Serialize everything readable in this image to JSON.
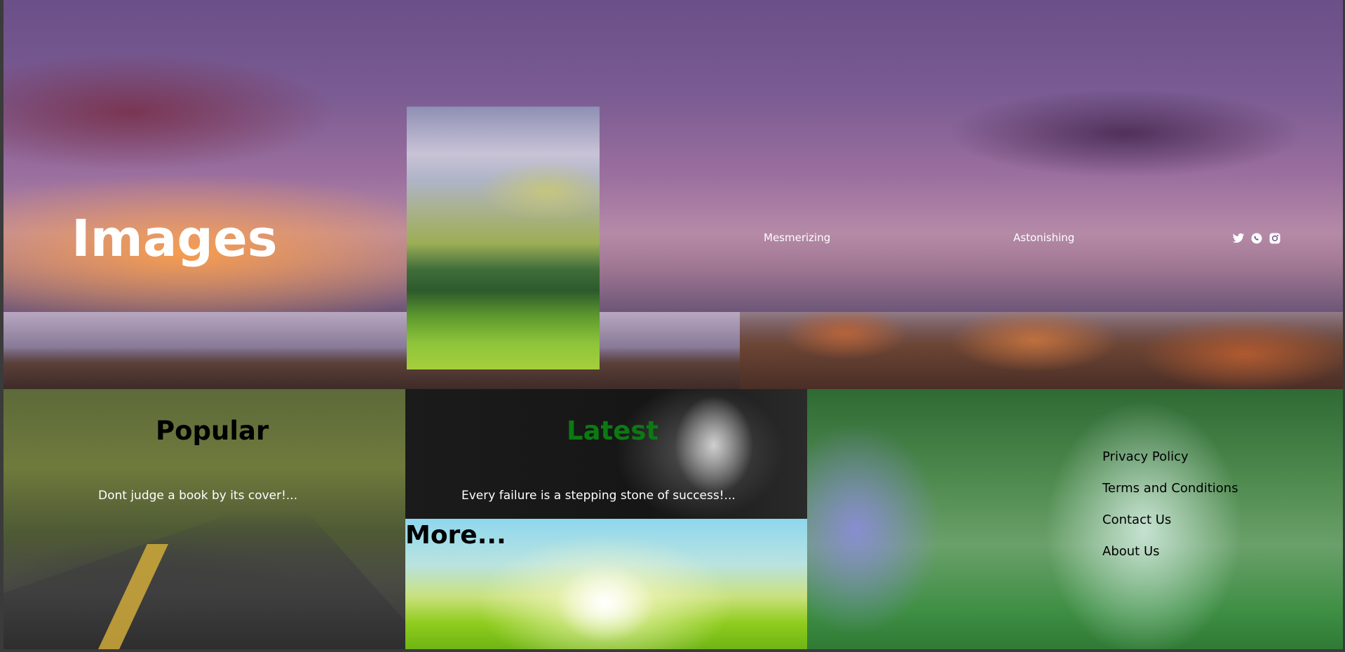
{
  "header": {
    "title": "Images",
    "nav": [
      {
        "label": "Mesmerizing"
      },
      {
        "label": "Astonishing"
      }
    ],
    "social_icons": [
      "twitter-icon",
      "whatsapp-icon",
      "instagram-icon"
    ]
  },
  "panels": {
    "popular": {
      "heading": "Popular",
      "quote": "Dont judge a book by its cover!..."
    },
    "latest": {
      "heading": "Latest",
      "quote": "Every failure is a stepping stone of success!...",
      "heading_color": "#0b7a12"
    },
    "more": {
      "heading": "More..."
    }
  },
  "footer": {
    "links": [
      {
        "label": "Privacy Policy"
      },
      {
        "label": "Terms and Conditions"
      },
      {
        "label": "Contact Us"
      },
      {
        "label": "About Us"
      }
    ]
  }
}
